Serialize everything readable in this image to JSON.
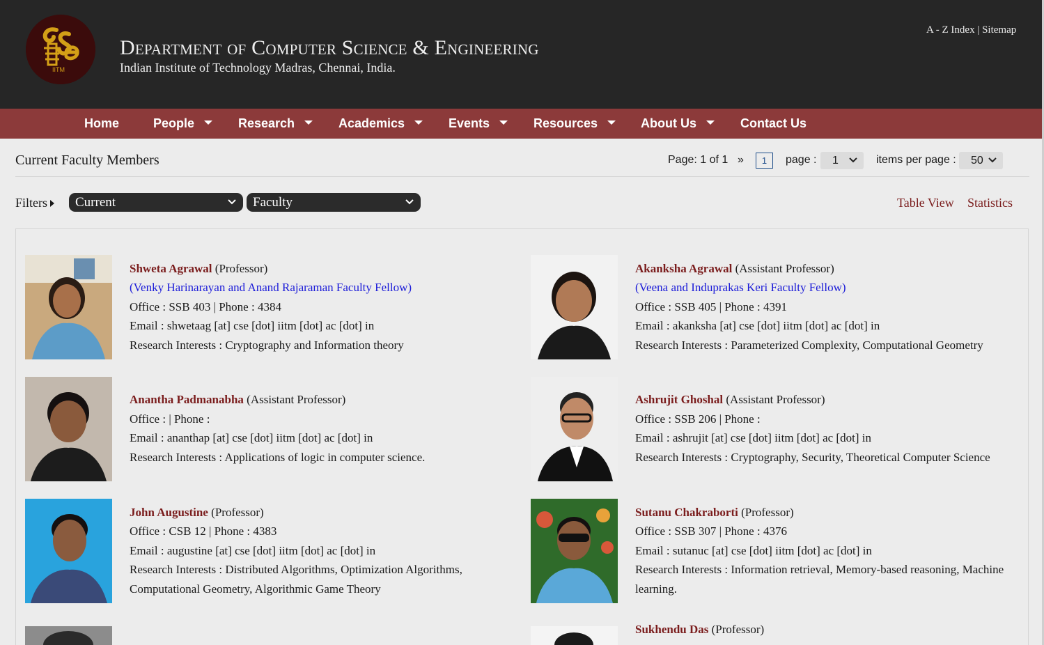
{
  "header": {
    "title": "Department of Computer Science & Engineering",
    "subtitle": "Indian Institute of Technology Madras, Chennai, India.",
    "az_index": "A - Z Index",
    "separator": "|",
    "sitemap": "Sitemap",
    "logo_text": "IITM"
  },
  "nav": {
    "items": [
      {
        "label": "Home",
        "has_dropdown": false
      },
      {
        "label": "People",
        "has_dropdown": true
      },
      {
        "label": "Research",
        "has_dropdown": true
      },
      {
        "label": "Academics",
        "has_dropdown": true
      },
      {
        "label": "Events",
        "has_dropdown": true
      },
      {
        "label": "Resources",
        "has_dropdown": true
      },
      {
        "label": "About Us",
        "has_dropdown": true
      },
      {
        "label": "Contact Us",
        "has_dropdown": false
      }
    ]
  },
  "listing": {
    "heading": "Current Faculty Members",
    "page_info": "Page: 1 of 1",
    "next_symbol": "»",
    "current_page": "1",
    "page_label": "page :",
    "page_select_value": "1",
    "items_label": "items per page :",
    "items_select_value": "50"
  },
  "filters": {
    "label": "Filters",
    "status_value": "Current",
    "category_value": "Faculty",
    "table_view": "Table View",
    "statistics": "Statistics"
  },
  "faculty": [
    {
      "name": "Shweta Agrawal",
      "designation": "(Professor)",
      "fellow": "(Venky Harinarayan and Anand Rajaraman Faculty Fellow)",
      "office": "Office : SSB 403 | Phone : 4384",
      "email": "Email : shwetaag [at] cse [dot] iitm [dot] ac [dot] in",
      "interests": [
        "Research Interests : Cryptography and Information theory"
      ]
    },
    {
      "name": "Akanksha Agrawal",
      "designation": "(Assistant Professor)",
      "fellow": "(Veena and Induprakas Keri Faculty Fellow)",
      "office": "Office : SSB 405 | Phone : 4391",
      "email": "Email : akanksha [at] cse [dot] iitm [dot] ac [dot] in",
      "interests": [
        "Research Interests : Parameterized Complexity, Computational Geometry"
      ]
    },
    {
      "name": "Anantha Padmanabha",
      "designation": "(Assistant Professor)",
      "fellow": "",
      "office": "Office : | Phone :",
      "email": "Email : ananthap [at] cse [dot] iitm [dot] ac [dot] in",
      "interests": [
        "Research Interests : Applications of logic in computer science."
      ]
    },
    {
      "name": "Ashrujit Ghoshal",
      "designation": "(Assistant Professor)",
      "fellow": "",
      "office": "Office : SSB 206 | Phone :",
      "email": "Email : ashrujit [at] cse [dot] iitm [dot] ac [dot] in",
      "interests": [
        "Research Interests : Cryptography, Security, Theoretical Computer Science"
      ]
    },
    {
      "name": "John Augustine",
      "designation": "(Professor)",
      "fellow": "",
      "office": "Office : CSB 12 | Phone : 4383",
      "email": "Email : augustine [at] cse [dot] iitm [dot] ac [dot] in",
      "interests": [
        "Research Interests : Distributed Algorithms, Optimization Algorithms,",
        "Computational Geometry, Algorithmic Game Theory"
      ]
    },
    {
      "name": "Sutanu Chakraborti",
      "designation": "(Professor)",
      "fellow": "",
      "office": "Office : SSB 307 | Phone : 4376",
      "email": "Email : sutanuc [at] cse [dot] iitm [dot] ac [dot] in",
      "interests": [
        "Research Interests : Information retrieval, Memory-based reasoning, Machine",
        "learning."
      ]
    },
    {
      "name": "Sukhendu Das",
      "designation": "(Professor)",
      "fellow": "",
      "office": "",
      "email": "",
      "interests": []
    }
  ],
  "colors": {
    "header_bg": "#262626",
    "nav_bg": "#8c3a3a",
    "name_link": "#7a1c1c",
    "fellow_link": "#1a1ad8",
    "logo_gold": "#d4a017"
  }
}
